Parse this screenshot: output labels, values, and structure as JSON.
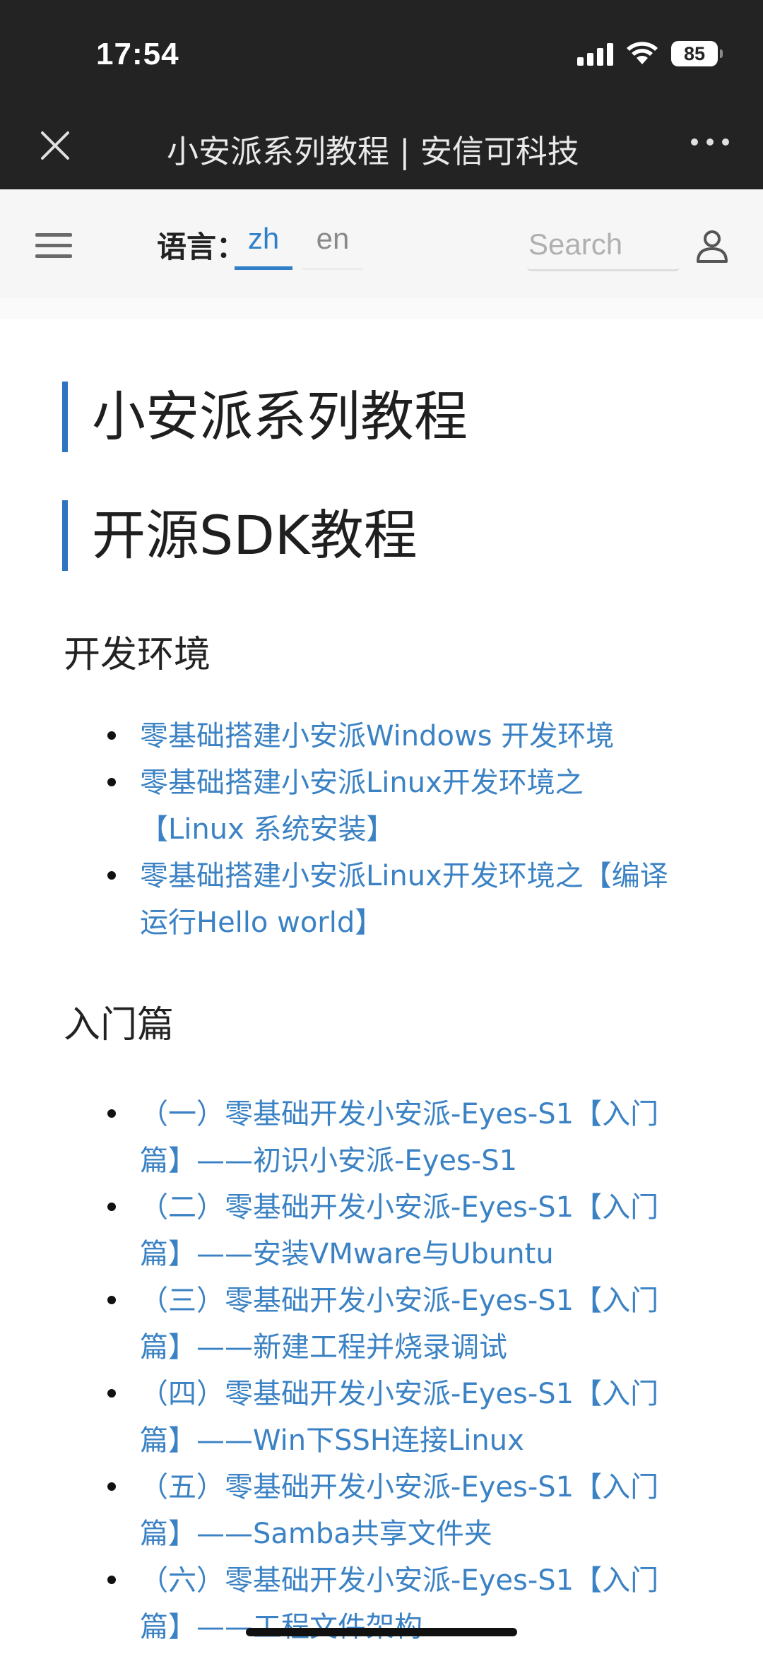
{
  "status_bar": {
    "time": "17:54",
    "battery": "85"
  },
  "browser_header": {
    "title": "小安派系列教程 | 安信可科技"
  },
  "navbar": {
    "lang_label": "语言：",
    "lang_options": [
      "zh",
      "en"
    ],
    "selected_lang": "zh",
    "search_placeholder": "Search"
  },
  "content": {
    "heading1": "小安派系列教程",
    "heading2": "开源SDK教程",
    "sections": [
      {
        "title": "开发环境",
        "links": [
          "零基础搭建小安派Windows 开发环境",
          "零基础搭建小安派Linux开发环境之【Linux 系统安装】",
          "零基础搭建小安派Linux开发环境之【编译运行Hello world】"
        ]
      },
      {
        "title": "入门篇",
        "links": [
          "（一）零基础开发小安派-Eyes-S1【入门篇】——初识小安派-Eyes-S1",
          "（二）零基础开发小安派-Eyes-S1【入门篇】——安装VMware与Ubuntu",
          "（三）零基础开发小安派-Eyes-S1【入门篇】——新建工程并烧录调试",
          "（四）零基础开发小安派-Eyes-S1【入门篇】——Win下SSH连接Linux",
          "（五）零基础开发小安派-Eyes-S1【入门篇】——Samba共享文件夹",
          "（六）零基础开发小安派-Eyes-S1【入门篇】——工程文件架构"
        ]
      }
    ]
  },
  "colors": {
    "link": "#3b82c4",
    "accent": "#2f74c0",
    "header_bg": "#232323"
  }
}
